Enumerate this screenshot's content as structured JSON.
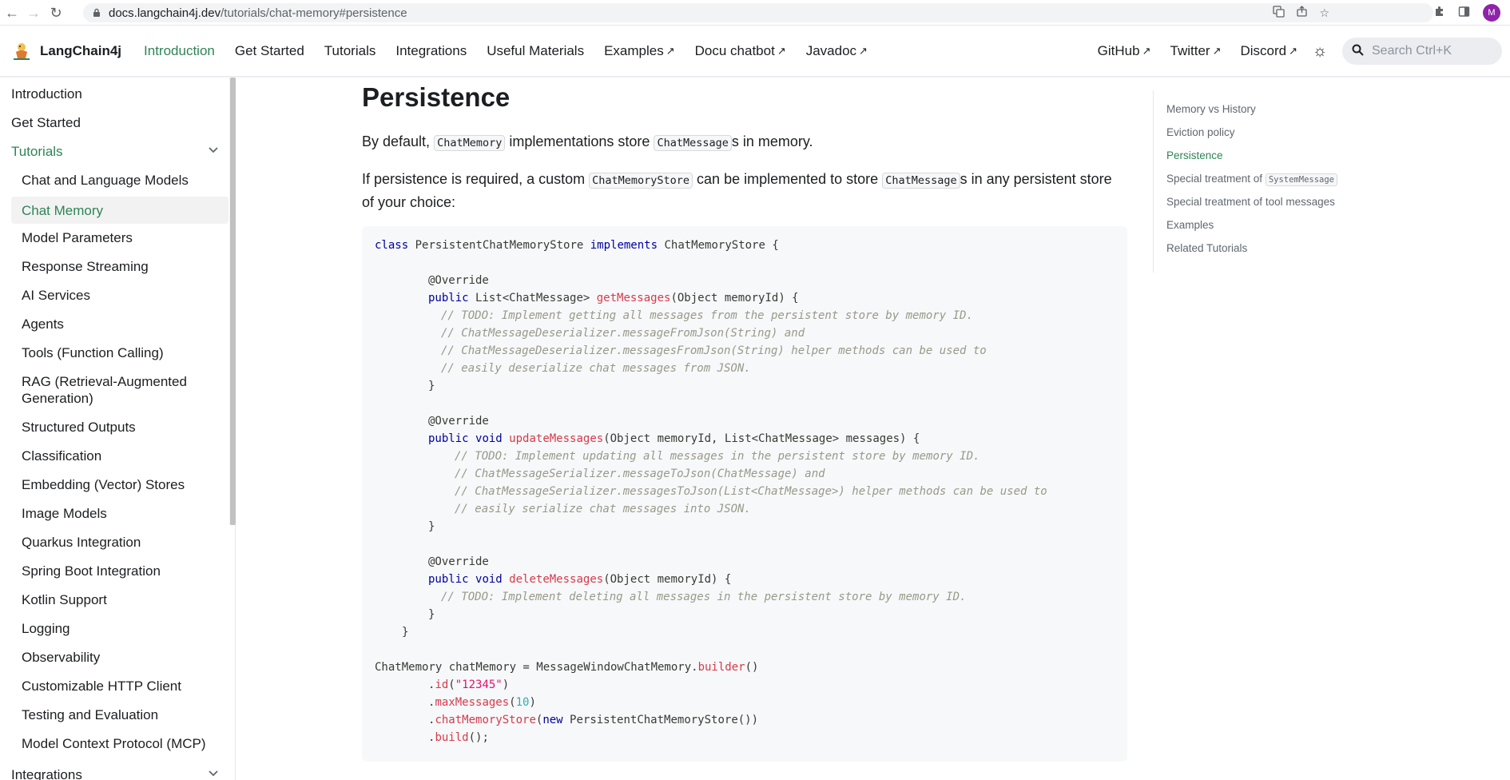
{
  "browser": {
    "url_host": "docs.langchain4j.dev",
    "url_path": "/tutorials/chat-memory#persistence",
    "profile_initial": "M"
  },
  "navbar": {
    "brand": "LangChain4j",
    "links": [
      {
        "label": "Introduction",
        "active": true,
        "external": false
      },
      {
        "label": "Get Started",
        "external": false
      },
      {
        "label": "Tutorials",
        "external": false
      },
      {
        "label": "Integrations",
        "external": false
      },
      {
        "label": "Useful Materials",
        "external": false
      },
      {
        "label": "Examples",
        "external": true
      },
      {
        "label": "Docu chatbot",
        "external": true
      },
      {
        "label": "Javadoc",
        "external": true
      }
    ],
    "right_links": [
      {
        "label": "GitHub"
      },
      {
        "label": "Twitter"
      },
      {
        "label": "Discord"
      }
    ],
    "search_placeholder": "Search Ctrl+K"
  },
  "sidebar": {
    "items": [
      {
        "label": "Introduction"
      },
      {
        "label": "Get Started"
      },
      {
        "label": "Tutorials",
        "expanded": true
      },
      {
        "label": "Chat and Language Models"
      },
      {
        "label": "Chat Memory",
        "selected": true
      },
      {
        "label": "Model Parameters"
      },
      {
        "label": "Response Streaming"
      },
      {
        "label": "AI Services"
      },
      {
        "label": "Agents"
      },
      {
        "label": "Tools (Function Calling)"
      },
      {
        "label": "RAG (Retrieval-Augmented Generation)"
      },
      {
        "label": "Structured Outputs"
      },
      {
        "label": "Classification"
      },
      {
        "label": "Embedding (Vector) Stores"
      },
      {
        "label": "Image Models"
      },
      {
        "label": "Quarkus Integration"
      },
      {
        "label": "Spring Boot Integration"
      },
      {
        "label": "Kotlin Support"
      },
      {
        "label": "Logging"
      },
      {
        "label": "Observability"
      },
      {
        "label": "Customizable HTTP Client"
      },
      {
        "label": "Testing and Evaluation"
      },
      {
        "label": "Model Context Protocol (MCP)"
      },
      {
        "label": "Integrations"
      }
    ]
  },
  "main": {
    "title": "Persistence",
    "p1": {
      "a": "By default, ",
      "code1": "ChatMemory",
      "b": " implementations store ",
      "code2": "ChatMessage",
      "c": "s in memory."
    },
    "p2": {
      "a": "If persistence is required, a custom ",
      "code1": "ChatMemoryStore",
      "b": " can be implemented to store ",
      "code2": "ChatMessage",
      "c": "s in any persistent store of your choice:"
    },
    "code": {
      "l1": {
        "kw1": "class",
        "t1": " PersistentChatMemoryStore ",
        "kw2": "implements",
        "t2": " ChatMemoryStore {"
      },
      "l2": "@Override",
      "l3": {
        "kw1": "public",
        "t1": " List<ChatMessage> ",
        "fn": "getMessages",
        "t2": "(Object memoryId) {"
      },
      "l4": "// TODO: Implement getting all messages from the persistent store by memory ID.",
      "l5": "// ChatMessageDeserializer.messageFromJson(String) and",
      "l6": "// ChatMessageDeserializer.messagesFromJson(String) helper methods can be used to",
      "l7": "// easily deserialize chat messages from JSON.",
      "l8": "}",
      "l9": "@Override",
      "l10": {
        "kw1": "public",
        "kw2": "void",
        "fn": "updateMessages",
        "t2": "(Object memoryId, List<ChatMessage> messages) {"
      },
      "l11": "// TODO: Implement updating all messages in the persistent store by memory ID.",
      "l12": "// ChatMessageSerializer.messageToJson(ChatMessage) and",
      "l13": "// ChatMessageSerializer.messagesToJson(List<ChatMessage>) helper methods can be used to",
      "l14": "// easily serialize chat messages into JSON.",
      "l15": "}",
      "l16": "@Override",
      "l17": {
        "kw1": "public",
        "kw2": "void",
        "fn": "deleteMessages",
        "t2": "(Object memoryId) {"
      },
      "l18": "// TODO: Implement deleting all messages in the persistent store by memory ID.",
      "l19": "}",
      "l20": "}",
      "l21": {
        "t1": "ChatMemory chatMemory = MessageWindowChatMemory.",
        "fn": "builder",
        "t2": "()"
      },
      "l22": {
        "t1": ".",
        "fn": "id",
        "t2": "(",
        "str": "\"12345\"",
        "t3": ")"
      },
      "l23": {
        "t1": ".",
        "fn": "maxMessages",
        "t2": "(",
        "num": "10",
        "t3": ")"
      },
      "l24": {
        "t1": ".",
        "fn": "chatMemoryStore",
        "t2": "(",
        "kw": "new",
        "t3": " PersistentChatMemoryStore())"
      },
      "l25": {
        "t1": ".",
        "fn": "build",
        "t2": "();"
      }
    }
  },
  "toc": {
    "items": [
      {
        "label": "Memory vs History"
      },
      {
        "label": "Eviction policy"
      },
      {
        "label": "Persistence",
        "active": true
      },
      {
        "label": "Special treatment of ",
        "code": "SystemMessage"
      },
      {
        "label": "Special treatment of tool messages"
      },
      {
        "label": "Examples"
      },
      {
        "label": "Related Tutorials"
      }
    ]
  },
  "colors": {
    "accent": "#2e8555",
    "code_bg": "#f6f8fa",
    "keyword": "#00009f",
    "function": "#d73a49",
    "comment": "#999988"
  }
}
